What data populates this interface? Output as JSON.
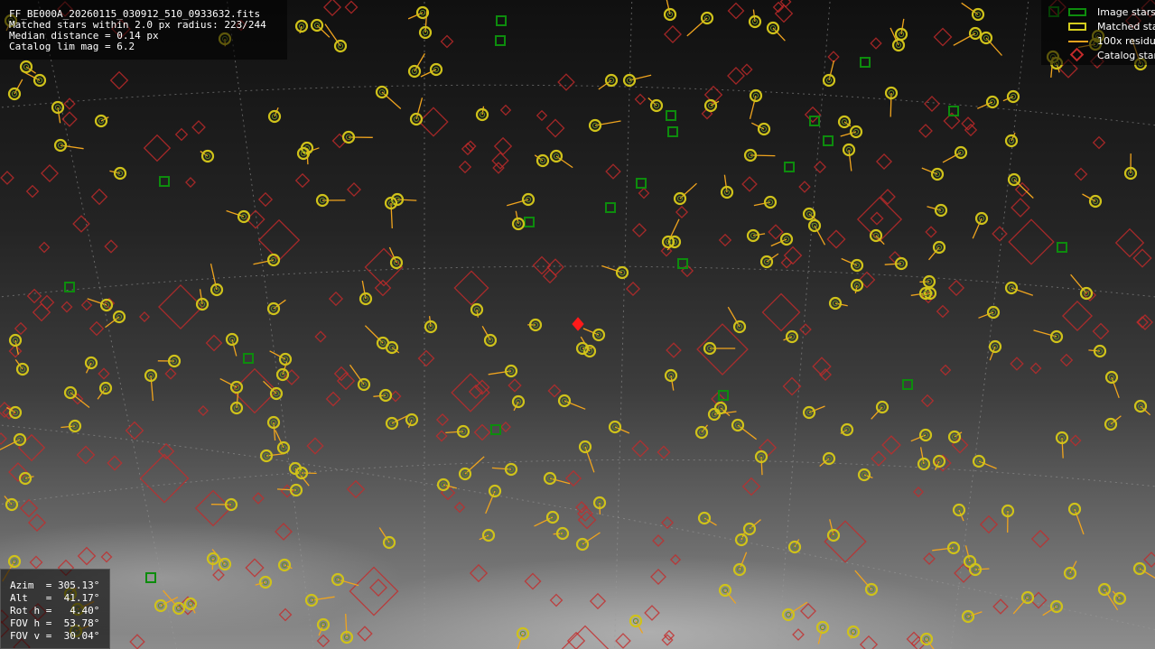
{
  "header": {
    "file_name": "FF_BE000A_20260115_030912_510_0933632.fits",
    "matched_line": "Matched stars within 2.0 px radius: 223/244",
    "median_line": "Median distance = 0.14 px",
    "catalog_line": "Catalog lim mag = 6.2"
  },
  "legend": {
    "items": [
      {
        "label": "Image stars",
        "color": "#0d8c0d",
        "kind": "box"
      },
      {
        "label": "Matched stars",
        "color": "#d3cc1e",
        "kind": "box"
      },
      {
        "label": "100x residuals",
        "color": "#f0a41e",
        "kind": "line"
      },
      {
        "label": "Catalog stars",
        "color": "#c42a2a",
        "kind": "diamond"
      }
    ]
  },
  "pointing": {
    "azim": "Azim  = 305.13°",
    "alt": "Alt   =  41.17°",
    "rot": "Rot h =   4.40°",
    "fov_h": "FOV h =  53.78°",
    "fov_v": "FOV v =  30.04°"
  },
  "colors": {
    "matched": "#cfc21a",
    "matched_inner": "#6b8f1f",
    "residual": "#f0a41e",
    "image_star": "#0d8c0d",
    "catalog": "#c42a2a",
    "center_marker": "#ff1a1a",
    "grid": "#9a9a9a"
  },
  "icons": {
    "center": "red-crosshair-diamond"
  }
}
